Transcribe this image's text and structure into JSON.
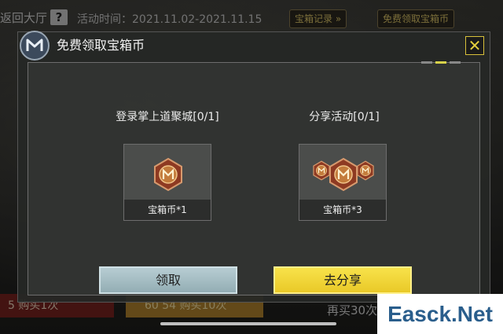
{
  "background": {
    "back_label": "返回大厅",
    "help_label": "?",
    "activity_time": "活动时间：2021.11.02-2021.11.15",
    "chest_record_label": "宝箱记录 »",
    "free_chest_label": "免费领取宝箱币",
    "bottom_left_label": "5  购买1次",
    "bottom_mid_label": "60  54 购买10次",
    "bottom_right_label": "再买30次"
  },
  "modal": {
    "title": "免费领取宝箱币",
    "close_symbol": "✕",
    "tasks": [
      {
        "label": "登录掌上道聚城[0/1]",
        "reward": "宝箱币*1",
        "coin_count": 1
      },
      {
        "label": "分享活动[0/1]",
        "reward": "宝箱币*3",
        "coin_count": 3
      }
    ],
    "claim_label": "领取",
    "share_label": "去分享"
  },
  "watermark": "Easck.Net",
  "colors": {
    "accent_yellow": "#f2d83a",
    "claim_blue": "#a7bec4",
    "coin_bronze": "#a4462a"
  }
}
